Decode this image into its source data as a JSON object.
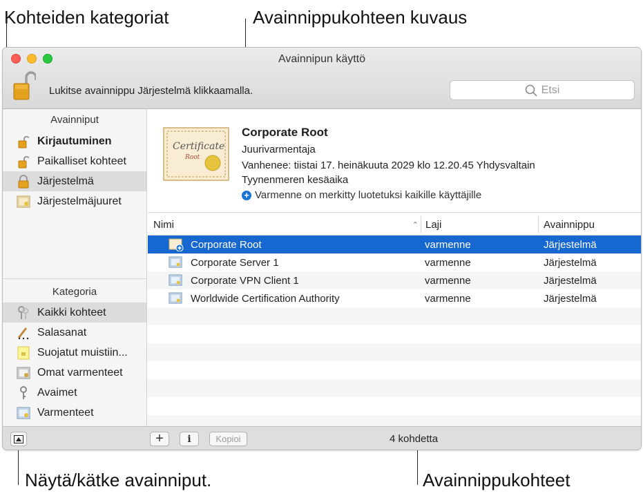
{
  "callouts": {
    "categories": "Kohteiden kategoriat",
    "description": "Avainnippukohteen kuvaus",
    "toggle": "Näytä/kätke avainniput.",
    "items": "Avainnippukohteet"
  },
  "window": {
    "title": "Avainnipun käyttö",
    "lock_message": "Lukitse avainnippu Järjestelmä klikkaamalla.",
    "search_placeholder": "Etsi"
  },
  "sidebar": {
    "keychains_header": "Avainniput",
    "keychains": [
      {
        "label": "Kirjautuminen",
        "icon": "unlocked-icon"
      },
      {
        "label": "Paikalliset kohteet",
        "icon": "unlocked-icon"
      },
      {
        "label": "Järjestelmä",
        "icon": "locked-icon"
      },
      {
        "label": "Järjestelmäjuuret",
        "icon": "certificate-icon"
      }
    ],
    "category_header": "Kategoria",
    "categories": [
      {
        "label": "Kaikki kohteet",
        "icon": "all-items-icon"
      },
      {
        "label": "Salasanat",
        "icon": "password-icon"
      },
      {
        "label": "Suojatut muistiin...",
        "icon": "secure-note-icon"
      },
      {
        "label": "Omat varmenteet",
        "icon": "my-certificate-icon"
      },
      {
        "label": "Avaimet",
        "icon": "key-icon"
      },
      {
        "label": "Varmenteet",
        "icon": "certificate-icon"
      }
    ]
  },
  "detail": {
    "name": "Corporate Root",
    "kind": "Juurivarmentaja",
    "expires_line1": "Vanhenee: tiistai 17. heinäkuuta 2029 klo 12.20.45 Yhdysvaltain",
    "expires_line2": "Tyynenmeren kesäaika",
    "trust": "Varmenne on merkitty luotetuksi kaikille käyttäjille",
    "cert_text": "Certificate",
    "cert_sub": "Root"
  },
  "table": {
    "columns": [
      "Nimi",
      "Laji",
      "Avainnippu"
    ],
    "rows": [
      {
        "name": "Corporate Root",
        "kind": "varmenne",
        "keychain": "Järjestelmä"
      },
      {
        "name": "Corporate Server 1",
        "kind": "varmenne",
        "keychain": "Järjestelmä"
      },
      {
        "name": "Corporate VPN Client 1",
        "kind": "varmenne",
        "keychain": "Järjestelmä"
      },
      {
        "name": "Worldwide Certification Authority",
        "kind": "varmenne",
        "keychain": "Järjestelmä"
      }
    ]
  },
  "bottom": {
    "add_label": "+",
    "info_label": "i",
    "copy_label": "Kopioi",
    "count": "4 kohdetta"
  },
  "colors": {
    "selection": "#1767d0",
    "accent": "#1a74d6"
  }
}
